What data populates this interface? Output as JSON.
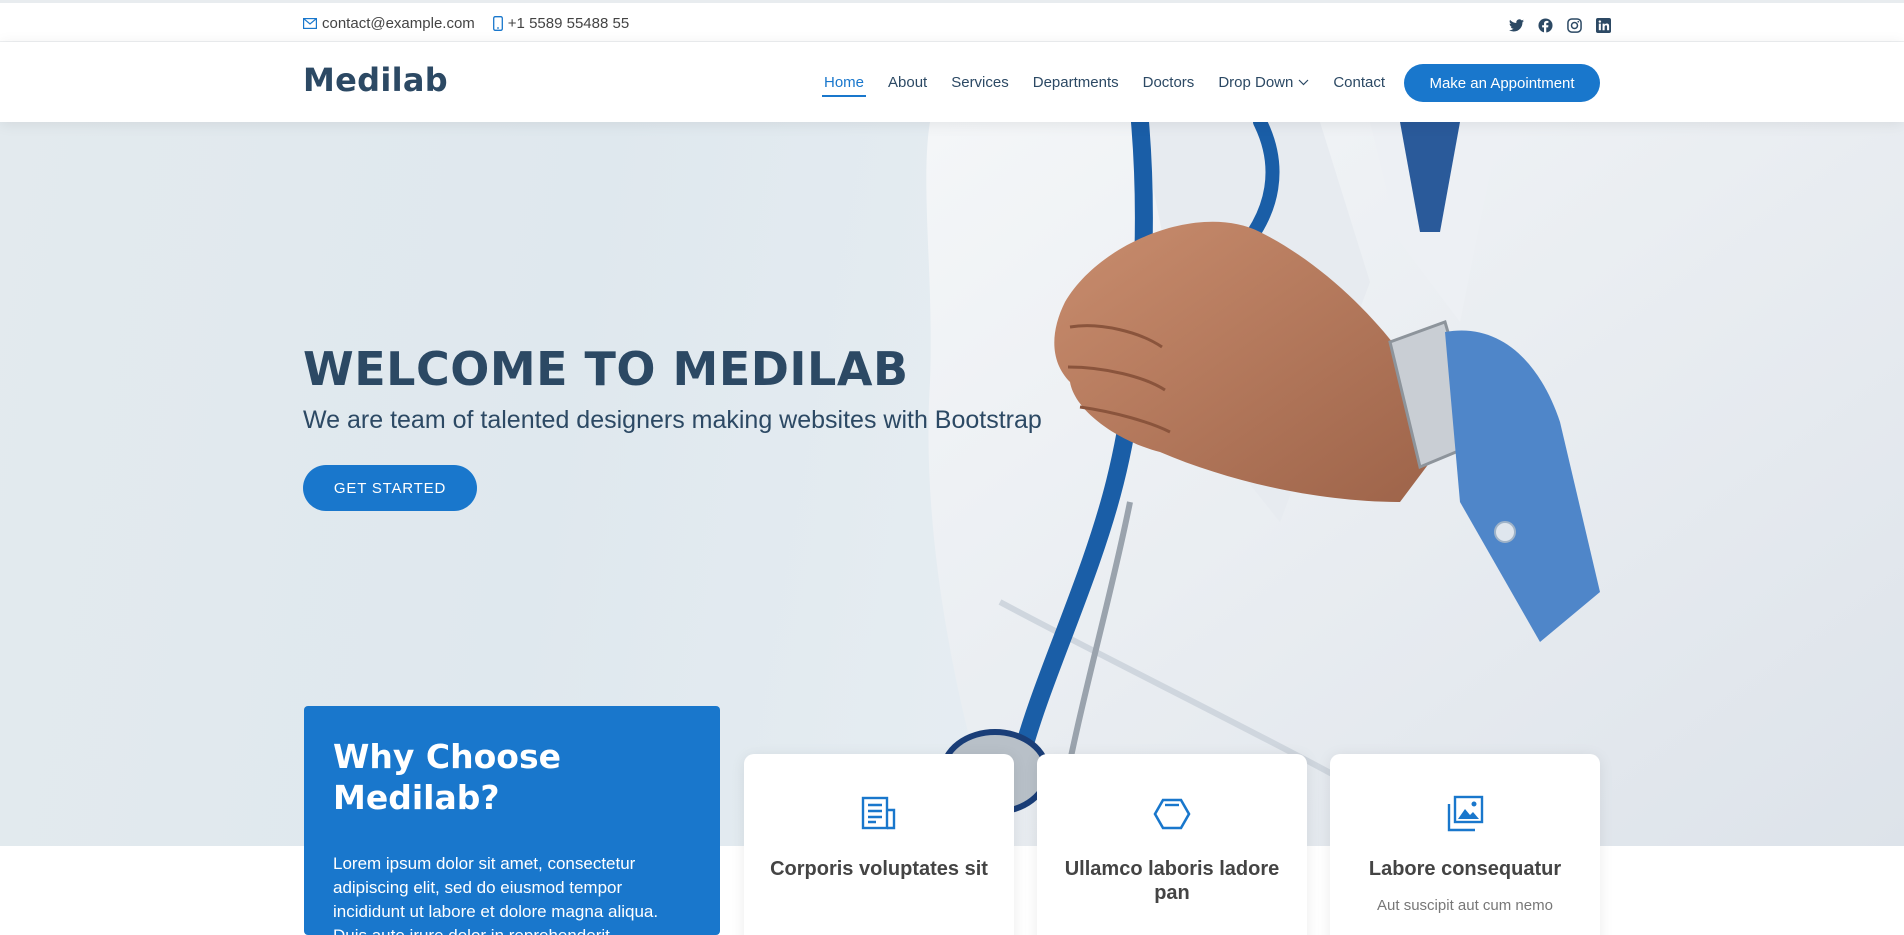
{
  "topbar": {
    "email": "contact@example.com",
    "phone": "+1 5589 55488 55",
    "social_icons": [
      "twitter-icon",
      "facebook-icon",
      "instagram-icon",
      "linkedin-icon"
    ]
  },
  "header": {
    "logo": "Medilab",
    "nav": [
      {
        "label": "Home",
        "active": true
      },
      {
        "label": "About"
      },
      {
        "label": "Services"
      },
      {
        "label": "Departments"
      },
      {
        "label": "Doctors"
      },
      {
        "label": "Drop Down",
        "dropdown": true
      },
      {
        "label": "Contact"
      }
    ],
    "cta": "Make an Appointment"
  },
  "hero": {
    "title": "WELCOME TO MEDILAB",
    "subtitle": "We are team of talented designers making websites with Bootstrap",
    "button": "GET STARTED"
  },
  "why": {
    "title": "Why Choose Medilab?",
    "text": "Lorem ipsum dolor sit amet, consectetur adipiscing elit, sed do eiusmod tempor incididunt ut labore et dolore magna aliqua. Duis aute irure dolor in reprehenderit"
  },
  "icon_boxes": [
    {
      "icon": "receipt-icon",
      "title": "Corporis voluptates sit",
      "text": ""
    },
    {
      "icon": "cube-icon",
      "title": "Ullamco laboris ladore pan",
      "text": ""
    },
    {
      "icon": "images-icon",
      "title": "Labore consequatur",
      "text": "Aut suscipit aut cum nemo"
    }
  ],
  "colors": {
    "accent": "#1977cc",
    "heading": "#2c4964"
  }
}
